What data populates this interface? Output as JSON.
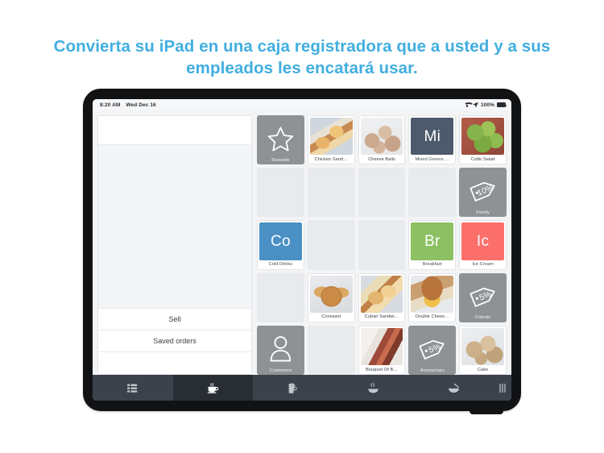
{
  "headline": {
    "line1": "Convierta su iPad en una caja registradora que a usted y a sus",
    "line2": "empleados les encatará usar.",
    "color": "#41aee0"
  },
  "device": {
    "frame_color": "#111214",
    "screen_bg": "#f3f4f6"
  },
  "status_bar": {
    "time": "8:20 AM",
    "date": "Wed Dec 16",
    "wifi_icon": "wifi-icon",
    "location_icon": "location-arrow-icon",
    "battery_percent": "100%",
    "battery_icon": "battery-full-icon"
  },
  "order_panel": {
    "actions": [
      {
        "label": "Sell"
      },
      {
        "label": "Saved orders"
      }
    ]
  },
  "grid": {
    "columns": 5,
    "rows": 5,
    "tiles": [
      {
        "label": "Rewards",
        "kind": "icon",
        "icon": "star-icon",
        "bg": "#8e9295"
      },
      {
        "label": "Chicken Sand…",
        "kind": "photo",
        "photo": "ph-sandwich"
      },
      {
        "label": "Cheese Balls",
        "kind": "photo",
        "photo": "ph-cheeseballs"
      },
      {
        "label": "Mixed Greens.…",
        "kind": "initials",
        "initials": "Mi",
        "bg": "#4d5a6b"
      },
      {
        "label": "Cobb Salad",
        "kind": "photo",
        "photo": "ph-salad"
      },
      {
        "label": "",
        "kind": "empty"
      },
      {
        "label": "",
        "kind": "empty"
      },
      {
        "label": "",
        "kind": "empty"
      },
      {
        "label": "",
        "kind": "empty"
      },
      {
        "label": "Family",
        "kind": "icon",
        "icon": "discount-tag-10-icon",
        "bg": "#8e9295",
        "tag_text": "10%"
      },
      {
        "label": "Cold Drinks",
        "kind": "initials",
        "initials": "Co",
        "bg": "#4a90c4"
      },
      {
        "label": "",
        "kind": "empty"
      },
      {
        "label": "",
        "kind": "empty"
      },
      {
        "label": "Breakfast",
        "kind": "initials",
        "initials": "Br",
        "bg": "#8cc063"
      },
      {
        "label": "Ice Cream",
        "kind": "initials",
        "initials": "Ic",
        "bg": "#fc6f6a"
      },
      {
        "label": "",
        "kind": "empty"
      },
      {
        "label": "Croissant",
        "kind": "photo",
        "photo": "ph-croissant"
      },
      {
        "label": "Cuban Sandwi…",
        "kind": "photo",
        "photo": "ph-cuban"
      },
      {
        "label": "Double Chees…",
        "kind": "photo",
        "photo": "ph-burger"
      },
      {
        "label": "Friends",
        "kind": "icon",
        "icon": "discount-tag-5-icon",
        "bg": "#8e9295",
        "tag_text": "5%"
      },
      {
        "label": "Customers",
        "kind": "icon",
        "icon": "person-icon",
        "bg": "#8e9295"
      },
      {
        "label": "",
        "kind": "empty"
      },
      {
        "label": "Bouquet Of B…",
        "kind": "photo",
        "photo": "ph-bacon"
      },
      {
        "label": "Anniversary",
        "kind": "icon",
        "icon": "discount-tag-5-icon",
        "bg": "#8e9295",
        "tag_text": "5%"
      },
      {
        "label": "Cake",
        "kind": "photo",
        "photo": "ph-cake"
      }
    ]
  },
  "tab_bar": {
    "bg": "#3c424b",
    "active_bg": "#292e35",
    "tabs": [
      {
        "icon": "grid-list-icon",
        "active": false
      },
      {
        "icon": "coffee-cup-icon",
        "active": true
      },
      {
        "icon": "beer-mug-icon",
        "active": false
      },
      {
        "icon": "hot-dish-icon",
        "active": false
      },
      {
        "icon": "bowl-icon",
        "active": false
      }
    ],
    "grip_icon": "drag-grip-icon"
  }
}
